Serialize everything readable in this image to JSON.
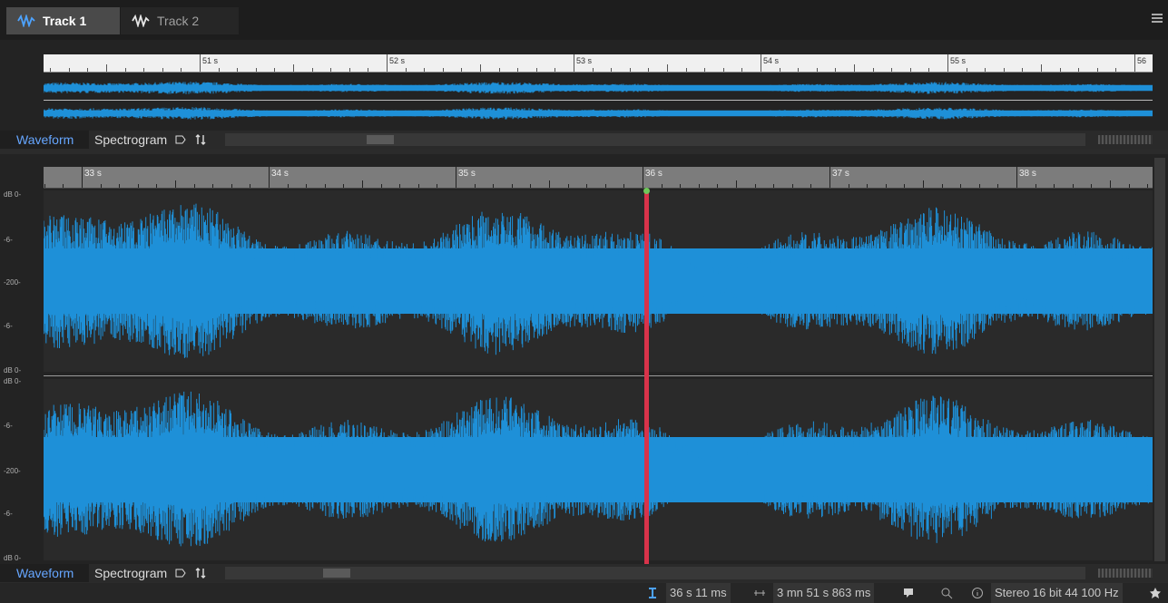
{
  "tabs": [
    {
      "label": "Track 1",
      "active": true
    },
    {
      "label": "Track 2",
      "active": false
    }
  ],
  "overview": {
    "ruler_labels": [
      "51 s",
      "52 s",
      "53 s",
      "54 s",
      "55 s",
      "56"
    ],
    "view_modes": {
      "waveform": "Waveform",
      "spectrogram": "Spectrogram"
    }
  },
  "main": {
    "ruler_labels": [
      "33 s",
      "34 s",
      "35 s",
      "36 s",
      "37 s",
      "38 s"
    ],
    "db_labels_ch1": [
      "dB 0-",
      "-6-",
      "-200-",
      "-6-",
      "dB 0-"
    ],
    "db_labels_ch2": [
      "dB 0-",
      "-6-",
      "-200-",
      "-6-",
      "dB 0-"
    ],
    "view_modes": {
      "waveform": "Waveform",
      "spectrogram": "Spectrogram"
    }
  },
  "status": {
    "cursor_position": "36 s 11 ms",
    "file_length": "3 mn 51 s 863 ms",
    "audio_format": "Stereo 16 bit 44 100 Hz"
  },
  "colors": {
    "waveform": "#1e90d8",
    "cursor": "#d8334a",
    "accent": "#66a6ff"
  }
}
